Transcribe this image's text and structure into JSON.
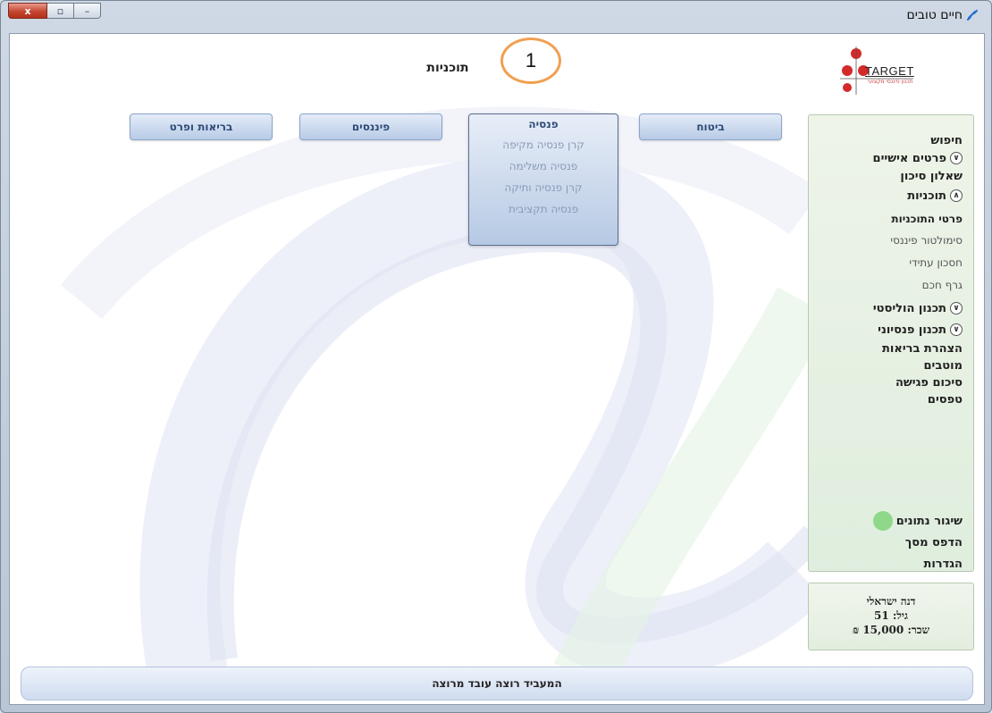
{
  "window": {
    "title": "חיים טובים",
    "controls": {
      "close": "x",
      "maximize": "▫",
      "minimize": "–"
    }
  },
  "logo": {
    "text": "TARGET",
    "subtext": "תכנון פיננסי מקצועי"
  },
  "page": {
    "title": "תוכניות",
    "annotation_number": "1"
  },
  "nav": {
    "insurance": "ביטוח",
    "pension": {
      "label": "פנסיה",
      "items": [
        "קרן פנסיה מקיפה",
        "פנסיה משלימה",
        "קרן פנסיה ותיקה",
        "פנסיה תקציבית"
      ]
    },
    "finance": "פיננסים",
    "health": "בריאות ופרט"
  },
  "sidebar": {
    "search": "חיפוש",
    "personal_details": "פרטים אישיים",
    "risk_questionnaire": "שאלון סיכון",
    "plans": "תוכניות",
    "plan_details": "פרטי התוכניות",
    "financial_simulator": "סימולטור פיננסי",
    "future_savings": "חסכון עתידי",
    "smart_graph": "גרף חכם",
    "holistic_planning": "תכנון הוליסטי",
    "pension_planning": "תכנון פנסיוני",
    "health_declaration": "הצהרת בריאות",
    "beneficiaries": "מוטבים",
    "meeting_summary": "סיכום פגישה",
    "forms": "טפסים",
    "sync_data": "שיגור נתונים",
    "print_screen": "הדפס מסך",
    "settings": "הגדרות",
    "sync_color": "#8fd88a"
  },
  "profile": {
    "name": "דנה ישראלי",
    "age": "גיל: 51",
    "salary": "שכר:  15,000 ₪"
  },
  "status": {
    "message": "המעביד רוצה עובד מרוצה"
  },
  "colors": {
    "nav_text": "#2d4a78",
    "annotation": "#f0a050",
    "close_button": "#c44730"
  }
}
